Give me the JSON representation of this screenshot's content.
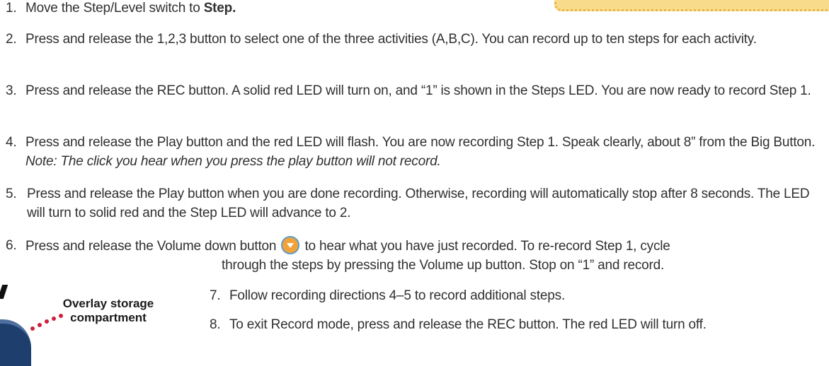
{
  "steps": [
    {
      "num": "1.",
      "text": "Move the Step/Level switch to ",
      "bold": "Step."
    },
    {
      "num": "2.",
      "text": "Press and release the 1,2,3 button to select one of the three activities (A,B,C). You can record up to ten steps for each activity."
    },
    {
      "num": "3.",
      "text": "Press and release the REC button. A solid red LED will turn on, and “1” is shown in the Steps LED. You are now ready to record Step 1."
    },
    {
      "num": "4.",
      "text": "Press and release the Play button and the red LED will flash. You are now recording Step 1. Speak clearly, about 8” from the Big Button. ",
      "italic": "Note: The click you hear when you press the play button will not record."
    },
    {
      "num": "5.",
      "text": "Press and release the Play button when you are done recording. Otherwise, recording will automatically stop after 8 seconds. The LED will turn to solid red and the Step LED will advance to 2."
    },
    {
      "num": "6.",
      "text_before": "Press and release the Volume down button",
      "text_after": " to hear what you have just recorded. To re-record Step 1, cycle",
      "text_cont": "through the steps by pressing the Volume up button. Stop on “1” and record."
    },
    {
      "num": "7.",
      "text": "Follow recording directions 4–5 to record additional steps."
    },
    {
      "num": "8.",
      "text": "To exit Record mode, press and release the REC button. The red LED will turn off."
    }
  ],
  "callout_label_line1": "Overlay storage",
  "callout_label_line2": "compartment",
  "icons": {
    "volume_down": "volume-down-icon"
  },
  "colors": {
    "callout": "#f8dc8c",
    "dots": "#d01f3c",
    "icon": "#f3a23a",
    "device": "#1e3f6d"
  }
}
